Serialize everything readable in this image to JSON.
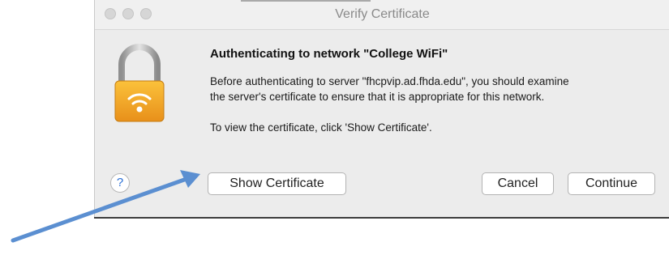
{
  "window": {
    "title": "Verify Certificate"
  },
  "dialog": {
    "heading": "Authenticating to network \"College WiFi\"",
    "body_line1": "Before authenticating to server \"fhcpvip.ad.fhda.edu\", you should examine",
    "body_line2": "the server's certificate to ensure that it is appropriate for this network.",
    "body_line3": "To view the certificate, click 'Show Certificate'.",
    "icon": "lock-wifi-icon"
  },
  "buttons": {
    "help_label": "?",
    "show_certificate_label": "Show Certificate",
    "cancel_label": "Cancel",
    "continue_label": "Continue"
  },
  "colors": {
    "annotation_arrow": "#5b8fd1",
    "lock_body": "#f2a41f",
    "help_glyph": "#2a6fd6"
  }
}
